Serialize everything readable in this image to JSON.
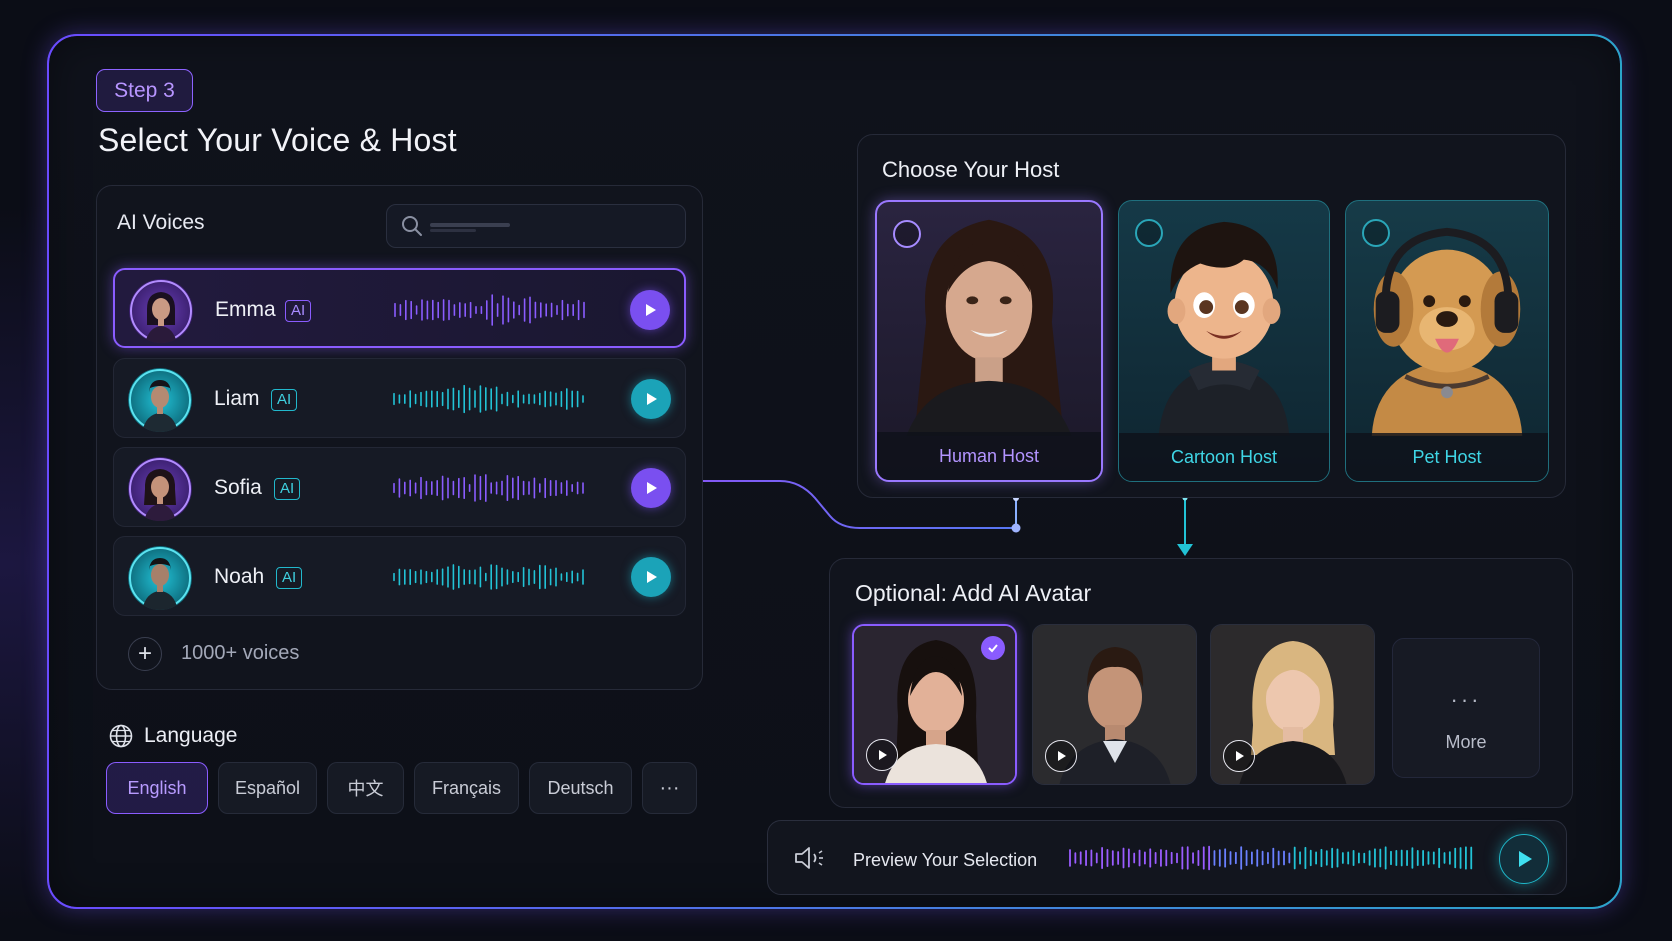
{
  "step": {
    "label": "Step 3"
  },
  "page": {
    "title": "Select Your Voice & Host"
  },
  "voices": {
    "title": "AI Voices",
    "search_placeholder": "",
    "items": [
      {
        "name": "Emma",
        "badge": "AI",
        "selected": true,
        "accent": "#8a5cff"
      },
      {
        "name": "Liam",
        "badge": "AI",
        "selected": false,
        "accent": "#22b8cc"
      },
      {
        "name": "Sofia",
        "badge": "AI",
        "selected": false,
        "accent": "#8a5cff"
      },
      {
        "name": "Noah",
        "badge": "AI",
        "selected": false,
        "accent": "#22b8cc"
      }
    ],
    "more_label": "1000+ voices"
  },
  "language": {
    "title": "Language",
    "options": [
      "English",
      "Español",
      "中文",
      "Français",
      "Deutsch",
      "···"
    ],
    "selected": "English"
  },
  "host": {
    "title": "Choose Your Host",
    "cards": [
      {
        "label": "Human Host",
        "selected": true
      },
      {
        "label": "Cartoon Host",
        "selected": false
      },
      {
        "label": "Pet Host",
        "selected": false
      }
    ]
  },
  "avatar": {
    "title": "Optional: Add AI Avatar",
    "more_dots": "···",
    "more_label": "More",
    "selected_index": 0
  },
  "preview": {
    "label": "Preview Your Selection"
  },
  "colors": {
    "purple": "#8a5cff",
    "teal": "#1fb7c9",
    "background": "#0d1018"
  }
}
